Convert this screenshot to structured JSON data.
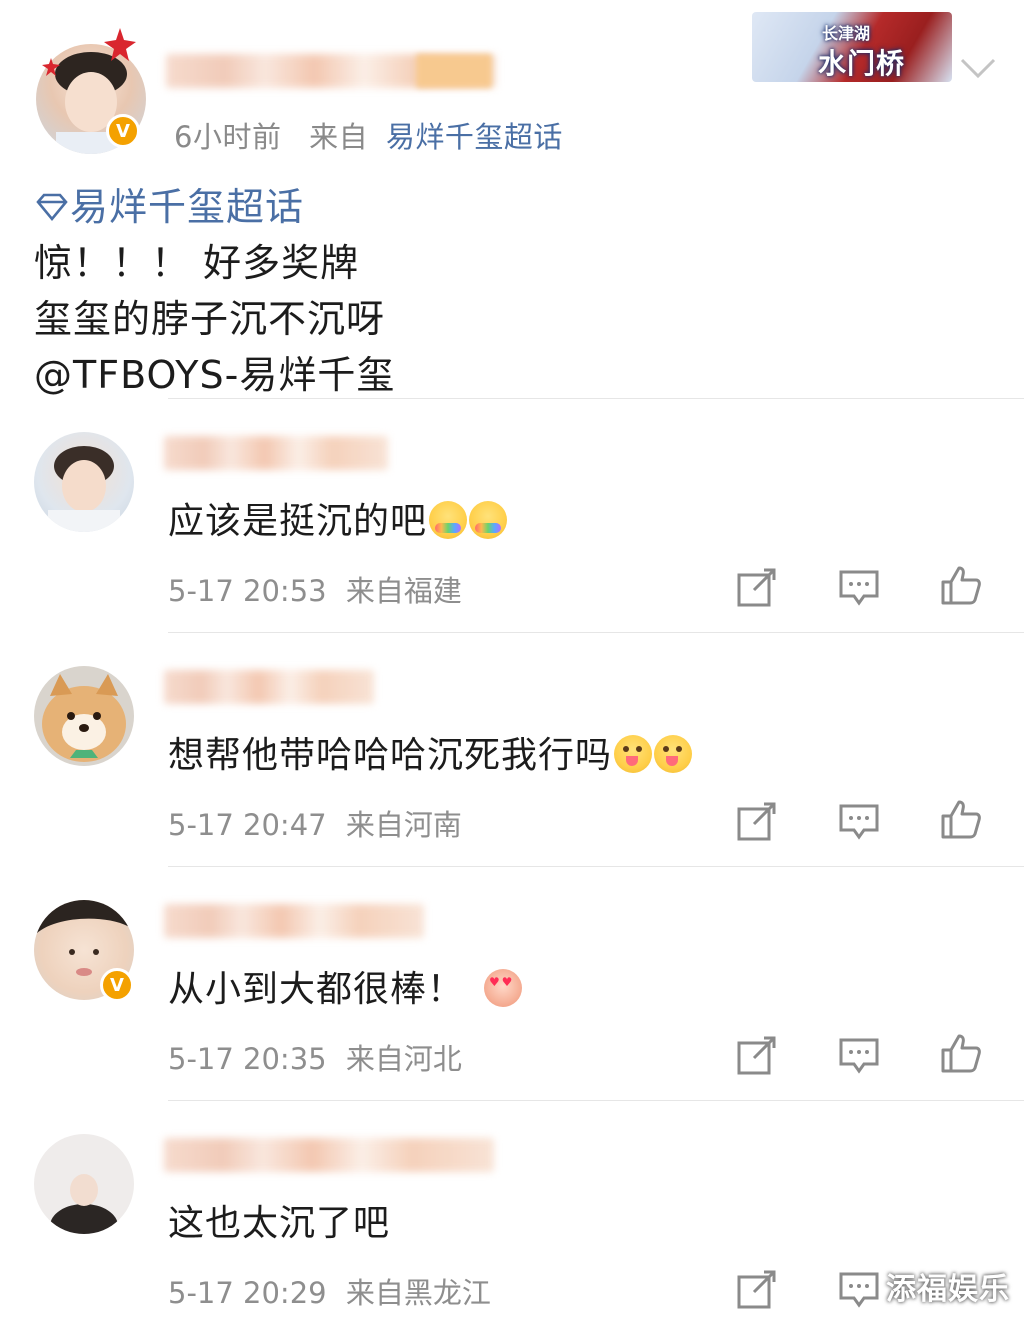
{
  "post": {
    "time": "6小时前",
    "source_prefix": "来自",
    "source": "易烊千玺超话",
    "topic": "易烊千玺超话",
    "lines": [
      "惊！！！ 好多奖牌",
      "玺玺的脖子沉不沉呀"
    ],
    "mention": "@TFBOYS-易烊千玺"
  },
  "banner": {
    "line1": "长津湖",
    "line2": "水门桥"
  },
  "comments": [
    {
      "text": "应该是挺沉的吧",
      "time": "5-17 20:53",
      "location": "来自福建",
      "emojis": [
        "rainbow",
        "rainbow"
      ]
    },
    {
      "text": "想帮他带哈哈哈沉死我行吗",
      "time": "5-17 20:47",
      "location": "来自河南",
      "emojis": [
        "tongue",
        "tongue"
      ]
    },
    {
      "text": "从小到大都很棒！",
      "time": "5-17 20:35",
      "location": "来自河北",
      "emojis": [
        "heart"
      ]
    },
    {
      "text": "这也太沉了吧",
      "time": "5-17 20:29",
      "location": "来自黑龙江",
      "emojis": []
    }
  ],
  "watermark": "添福娱乐",
  "colors": {
    "link": "#4a6fa5",
    "meta": "#8e8e8e",
    "badge": "#f4a100"
  }
}
